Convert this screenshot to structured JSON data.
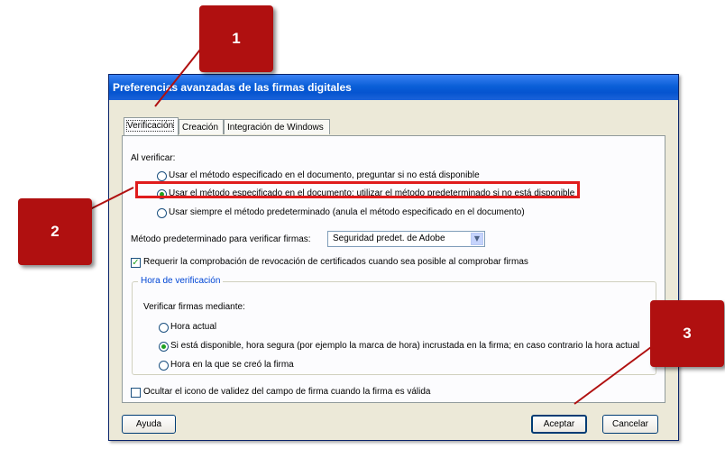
{
  "window": {
    "title": "Preferencias avanzadas de las firmas digitales"
  },
  "tabs": [
    {
      "label": "Verificación",
      "active": true
    },
    {
      "label": "Creación",
      "active": false
    },
    {
      "label": "Integración de Windows",
      "active": false
    }
  ],
  "verify": {
    "heading": "Al verificar:",
    "options": [
      {
        "label": "Usar el método especificado en el documento, preguntar si no está disponible",
        "selected": false
      },
      {
        "label": "Usar el método especificado en el documento; utilizar el método predeterminado si no está disponible",
        "selected": true
      },
      {
        "label": "Usar siempre el método predeterminado (anula el método especificado en el documento)",
        "selected": false
      }
    ],
    "default_method_label": "Método predeterminado para verificar firmas:",
    "default_method_value": "Seguridad predet. de Adobe",
    "revocation_label": "Requerir la comprobación de revocación de certificados cuando sea posible al comprobar firmas",
    "revocation_checked": true
  },
  "time_group": {
    "title": "Hora de verificación",
    "subheading": "Verificar firmas mediante:",
    "options": [
      {
        "label": "Hora actual",
        "selected": false
      },
      {
        "label": "Si está disponible, hora segura (por ejemplo la marca de hora) incrustada en la firma; en caso contrario la hora actual",
        "selected": true
      },
      {
        "label": "Hora en la que se creó la firma",
        "selected": false
      }
    ]
  },
  "hide_icon": {
    "label": "Ocultar el icono de validez del campo de firma cuando la firma es válida",
    "checked": false
  },
  "buttons": {
    "help": "Ayuda",
    "ok": "Aceptar",
    "cancel": "Cancelar"
  },
  "callouts": [
    "1",
    "2",
    "3"
  ],
  "colors": {
    "callout": "#b01010",
    "highlight": "#e01c1c",
    "titlebar": "#0554d0"
  }
}
